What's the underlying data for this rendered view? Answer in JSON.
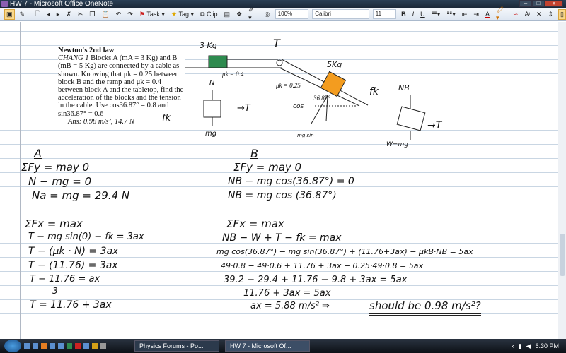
{
  "window": {
    "title": "HW 7 - Microsoft Office OneNote",
    "minimize": "–",
    "maximize": "□",
    "close": "x"
  },
  "toolbar": {
    "task": "Task",
    "tag": "Tag",
    "clip": "Clip",
    "zoom": "100%",
    "font": "Calibri",
    "size": "11",
    "bold": "B",
    "italic": "I",
    "underline": "U",
    "font_color": "A"
  },
  "problem": {
    "heading": "Newton's 2nd law",
    "ref": "CHANG 1",
    "body": " Blocks A (mA = 3 Kg) and B (mB = 5 Kg) are connected by a cable as shown. Knowing that μk = 0.25 between block B and the ramp and μk = 0.4 between block A and the tabletop, find the acceleration of the blocks and the tension in the cable. Use cos36.87° = 0.8 and sin36.87° = 0.6",
    "answer": "Ans: 0.98 m/s², 14.7 N"
  },
  "diagram": {
    "mass_a": "3 Kg",
    "mu_a": "μk = 0.4",
    "tension": "T",
    "mass_b": "5Kg",
    "mu_b": "μk = 0.25",
    "angle": "36.87°",
    "cos": "cos",
    "sin": "mg sin",
    "fk": "fk",
    "nb": "NB",
    "t": "T",
    "mg": "mg",
    "n": "N",
    "w": "W=mg"
  },
  "notes": {
    "a_head": "A",
    "a": [
      "ΣFy = may  0",
      "N − mg = 0",
      "Na = mg = 29.4  N",
      "ΣFx = max",
      "T − mg sin(0) − fk = 3ax",
      "T − (μk · N) = 3ax",
      "T − (11.76) = 3ax",
      "T − 11.76 = ax",
      "3",
      "T = 11.76 + 3ax"
    ],
    "b_head": "B",
    "b": [
      "ΣFy = may  0",
      "NB − mg cos(36.87°) = 0",
      "NB = mg cos (36.87°)",
      "ΣFx = max",
      "NB − W + T − fk = max",
      "mg cos(36.87°) − mg sin(36.87°) + (11.76+3ax) − μkB·NB = 5ax",
      "49·0.8 − 49·0.6 + 11.76 + 3ax − 0.25·49·0.8 = 5ax",
      "39.2 − 29.4 + 11.76 − 9.8 + 3ax = 5ax",
      "11.76 + 3ax = 5ax",
      "ax = 5.88 m/s²  ⇒",
      "should be 0.98 m/s²?"
    ]
  },
  "taskbar": {
    "tasks": [
      "Physics Forums - Po...",
      "HW 7 - Microsoft Of..."
    ],
    "clock": "6:30 PM"
  }
}
